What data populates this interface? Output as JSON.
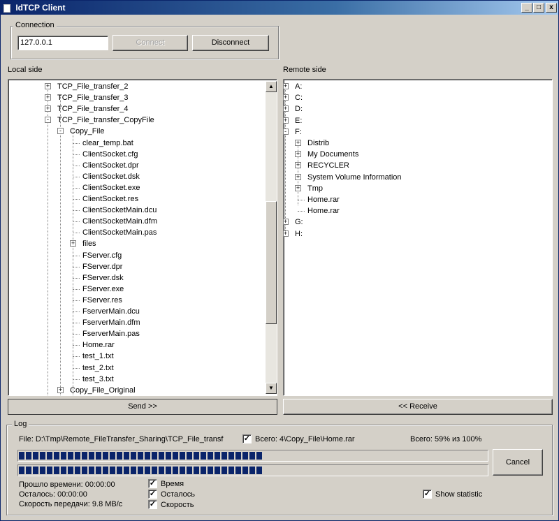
{
  "window": {
    "title": "IdTCP Client",
    "minimize_glyph": "_",
    "maximize_glyph": "□",
    "close_glyph": "x",
    "app_icon": "window-app-icon"
  },
  "connection": {
    "group_label": "Connection",
    "host_value": "127.0.0.1",
    "connect_label": "Connect",
    "disconnect_label": "Disconnect"
  },
  "local": {
    "label": "Local side",
    "nodes": [
      {
        "text": "TCP_File_transfer_2",
        "exp": "+"
      },
      {
        "text": "TCP_File_transfer_3",
        "exp": "+"
      },
      {
        "text": "TCP_File_transfer_4",
        "exp": "+"
      },
      {
        "text": "TCP_File_transfer_CopyFile",
        "exp": "-"
      },
      {
        "text": "Copy_File",
        "exp": "-"
      },
      {
        "text": "clear_temp.bat",
        "exp": ""
      },
      {
        "text": "ClientSocket.cfg",
        "exp": ""
      },
      {
        "text": "ClientSocket.dpr",
        "exp": ""
      },
      {
        "text": "ClientSocket.dsk",
        "exp": ""
      },
      {
        "text": "ClientSocket.exe",
        "exp": ""
      },
      {
        "text": "ClientSocket.res",
        "exp": ""
      },
      {
        "text": "ClientSocketMain.dcu",
        "exp": ""
      },
      {
        "text": "ClientSocketMain.dfm",
        "exp": ""
      },
      {
        "text": "ClientSocketMain.pas",
        "exp": ""
      },
      {
        "text": "files",
        "exp": "+"
      },
      {
        "text": "FServer.cfg",
        "exp": ""
      },
      {
        "text": "FServer.dpr",
        "exp": ""
      },
      {
        "text": "FServer.dsk",
        "exp": ""
      },
      {
        "text": "FServer.exe",
        "exp": ""
      },
      {
        "text": "FServer.res",
        "exp": ""
      },
      {
        "text": "FserverMain.dcu",
        "exp": ""
      },
      {
        "text": "FserverMain.dfm",
        "exp": ""
      },
      {
        "text": "FserverMain.pas",
        "exp": ""
      },
      {
        "text": "Home.rar",
        "exp": ""
      },
      {
        "text": "test_1.txt",
        "exp": ""
      },
      {
        "text": "test_2.txt",
        "exp": ""
      },
      {
        "text": "test_3.txt",
        "exp": ""
      },
      {
        "text": "Copy_File_Original",
        "exp": "+"
      }
    ],
    "scroll_up": "▲",
    "scroll_down": "▼"
  },
  "remote": {
    "label": "Remote side",
    "nodes": [
      {
        "text": "A:",
        "exp": "+"
      },
      {
        "text": "C:",
        "exp": "+"
      },
      {
        "text": "D:",
        "exp": "+"
      },
      {
        "text": "E:",
        "exp": "+"
      },
      {
        "text": "F:",
        "exp": "-"
      },
      {
        "text": "Distrib",
        "exp": "+"
      },
      {
        "text": "My Documents",
        "exp": "+"
      },
      {
        "text": "RECYCLER",
        "exp": "+"
      },
      {
        "text": "System Volume Information",
        "exp": "+"
      },
      {
        "text": "Tmp",
        "exp": "+"
      },
      {
        "text": "Home.rar",
        "exp": ""
      },
      {
        "text": "Home.rar",
        "exp": ""
      },
      {
        "text": "G:",
        "exp": "+"
      },
      {
        "text": "H:",
        "exp": "+"
      }
    ]
  },
  "actions": {
    "send_label": "Send >>",
    "receive_label": "<< Receive"
  },
  "log": {
    "group_label": "Log",
    "file_path": "File: D:\\Tmp\\Remote_FileTransfer_Sharing\\TCP_File_transf",
    "total_text": "Всего: 4\\Copy_File\\Home.rar",
    "total_progress_text": "Всего: 59% из 100%",
    "progress_1": 0.52,
    "progress_2": 0.52,
    "cancel_label": "Cancel",
    "elapsed": "Прошло времени: 00:00:00",
    "remaining": "Осталось: 00:00:00",
    "speed": "Скорость передачи: 9.8 MB/c",
    "chk_time_label": "Время",
    "chk_remaining_label": "Осталось",
    "chk_speed_label": "Скорость",
    "show_statistic_label": "Show statistic",
    "check_glyph": "✓"
  }
}
